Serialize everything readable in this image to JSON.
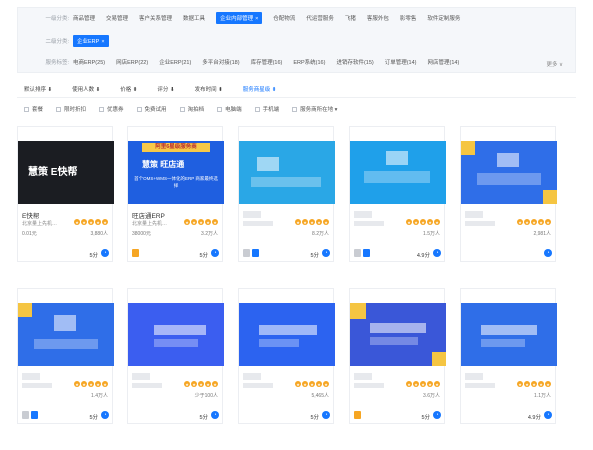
{
  "filters": {
    "row1": {
      "label": "一级分类:",
      "items": [
        "商品管理",
        "交易管理",
        "客户关系管理",
        "数据工具",
        "企业内部管理",
        "仓配物流",
        "代运营服务",
        "飞猪",
        "客服外包",
        "影零售",
        "软件定制服务"
      ],
      "active_index": 4
    },
    "row2": {
      "label": "二级分类:",
      "items": [
        "企业ERP"
      ],
      "active_index": 0
    },
    "row3": {
      "label": "服务标签:",
      "items": [
        "电商ERP(25)",
        "网店ERP(22)",
        "企业ERP(21)",
        "多平台对接(18)",
        "库存管理(16)",
        "ERP系统(16)",
        "进销存软件(15)",
        "订单管理(14)",
        "网店管理(14)"
      ]
    },
    "more_label": "更多 ∨"
  },
  "sort": [
    "默认排序 ⬇",
    "使用人数 ⬇",
    "价格 ⬍",
    "评分 ⬇",
    "发布时间 ⬍",
    "服务商星级 ⬍"
  ],
  "sort_active_index": 5,
  "checkboxes": [
    "套餐",
    "限时折扣",
    "优惠券",
    "免费试用",
    "淘拍档",
    "电脑端",
    "手机端",
    "服务商所在地 ▾"
  ],
  "colors": {
    "accent": "#1677ff",
    "star": "#f6a623"
  },
  "cards": [
    {
      "title": "E快帮",
      "sub": "北京量上先机…",
      "price": "0.01元",
      "sales": "3,880人",
      "score": "5分",
      "banner_text": "慧策 E快帮"
    },
    {
      "title": "旺店通ERP",
      "sub": "北京量上先机…",
      "price": "38000元",
      "sales": "3.2万人",
      "score": "5分",
      "banner_top": "阿里6星级服务商",
      "banner_text": "慧策 旺店通",
      "banner_sub": "首个OMS+WMS一体化的ERP 商家最终选择"
    },
    {
      "title": "",
      "sub": "",
      "price": "",
      "sales": "8.2万人",
      "score": "5分"
    },
    {
      "title": "",
      "sub": "",
      "price": "",
      "sales": "1.5万人",
      "score": "4.9分"
    },
    {
      "title": "",
      "sub": "",
      "price": "",
      "sales": "2,981人",
      "score": ""
    },
    {
      "title": "",
      "sub": "",
      "price": "",
      "sales": "1.4万人",
      "score": "5分"
    },
    {
      "title": "",
      "sub": "",
      "price": "",
      "sales": "少于100人",
      "score": "5分"
    },
    {
      "title": "",
      "sub": "",
      "price": "",
      "sales": "5,465人",
      "score": "5分"
    },
    {
      "title": "",
      "sub": "",
      "price": "",
      "sales": "3.6万人",
      "score": "5分"
    },
    {
      "title": "",
      "sub": "",
      "price": "",
      "sales": "1.1万人",
      "score": "4.9分"
    }
  ]
}
